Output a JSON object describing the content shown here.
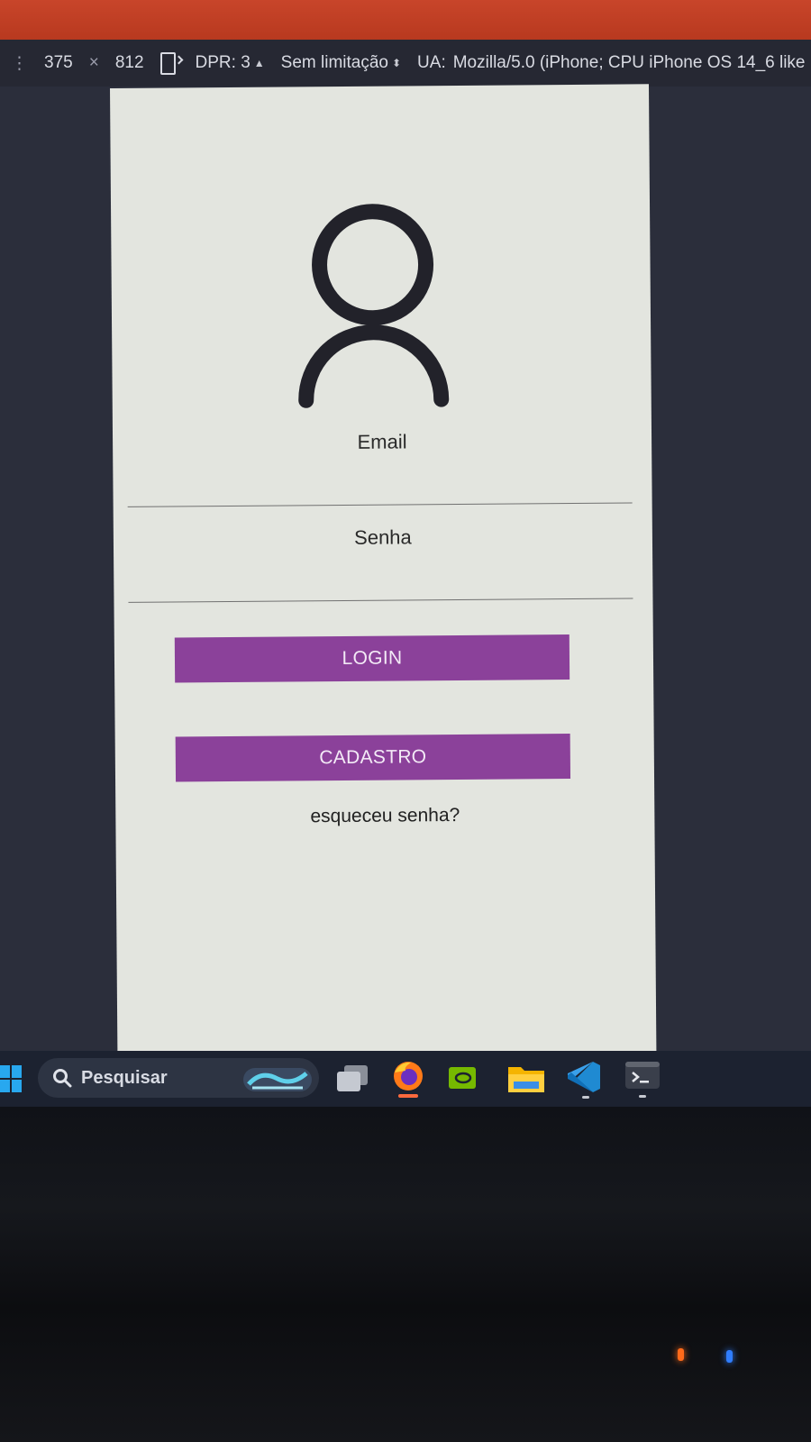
{
  "devtools": {
    "width": "375",
    "times": "×",
    "height": "812",
    "dpr": "DPR: 3",
    "throttle": "Sem limitação",
    "ua_label": "UA:",
    "ua_value": "Mozilla/5.0 (iPhone; CPU iPhone OS 14_6 like"
  },
  "form": {
    "email_label": "Email",
    "password_label": "Senha",
    "login_button": "LOGIN",
    "signup_button": "CADASTRO",
    "forgot_link": "esqueceu senha?"
  },
  "taskbar": {
    "search_placeholder": "Pesquisar",
    "apps": [
      "windows-start-icon",
      "search-icon",
      "widgets-icon",
      "task-view-icon",
      "firefox-icon",
      "nvidia-icon",
      "file-explorer-icon",
      "vscode-icon",
      "terminal-icon"
    ]
  },
  "colors": {
    "button": "#8b419a",
    "page_background": "#e3e5df",
    "browser_bar": "#c8452a"
  }
}
